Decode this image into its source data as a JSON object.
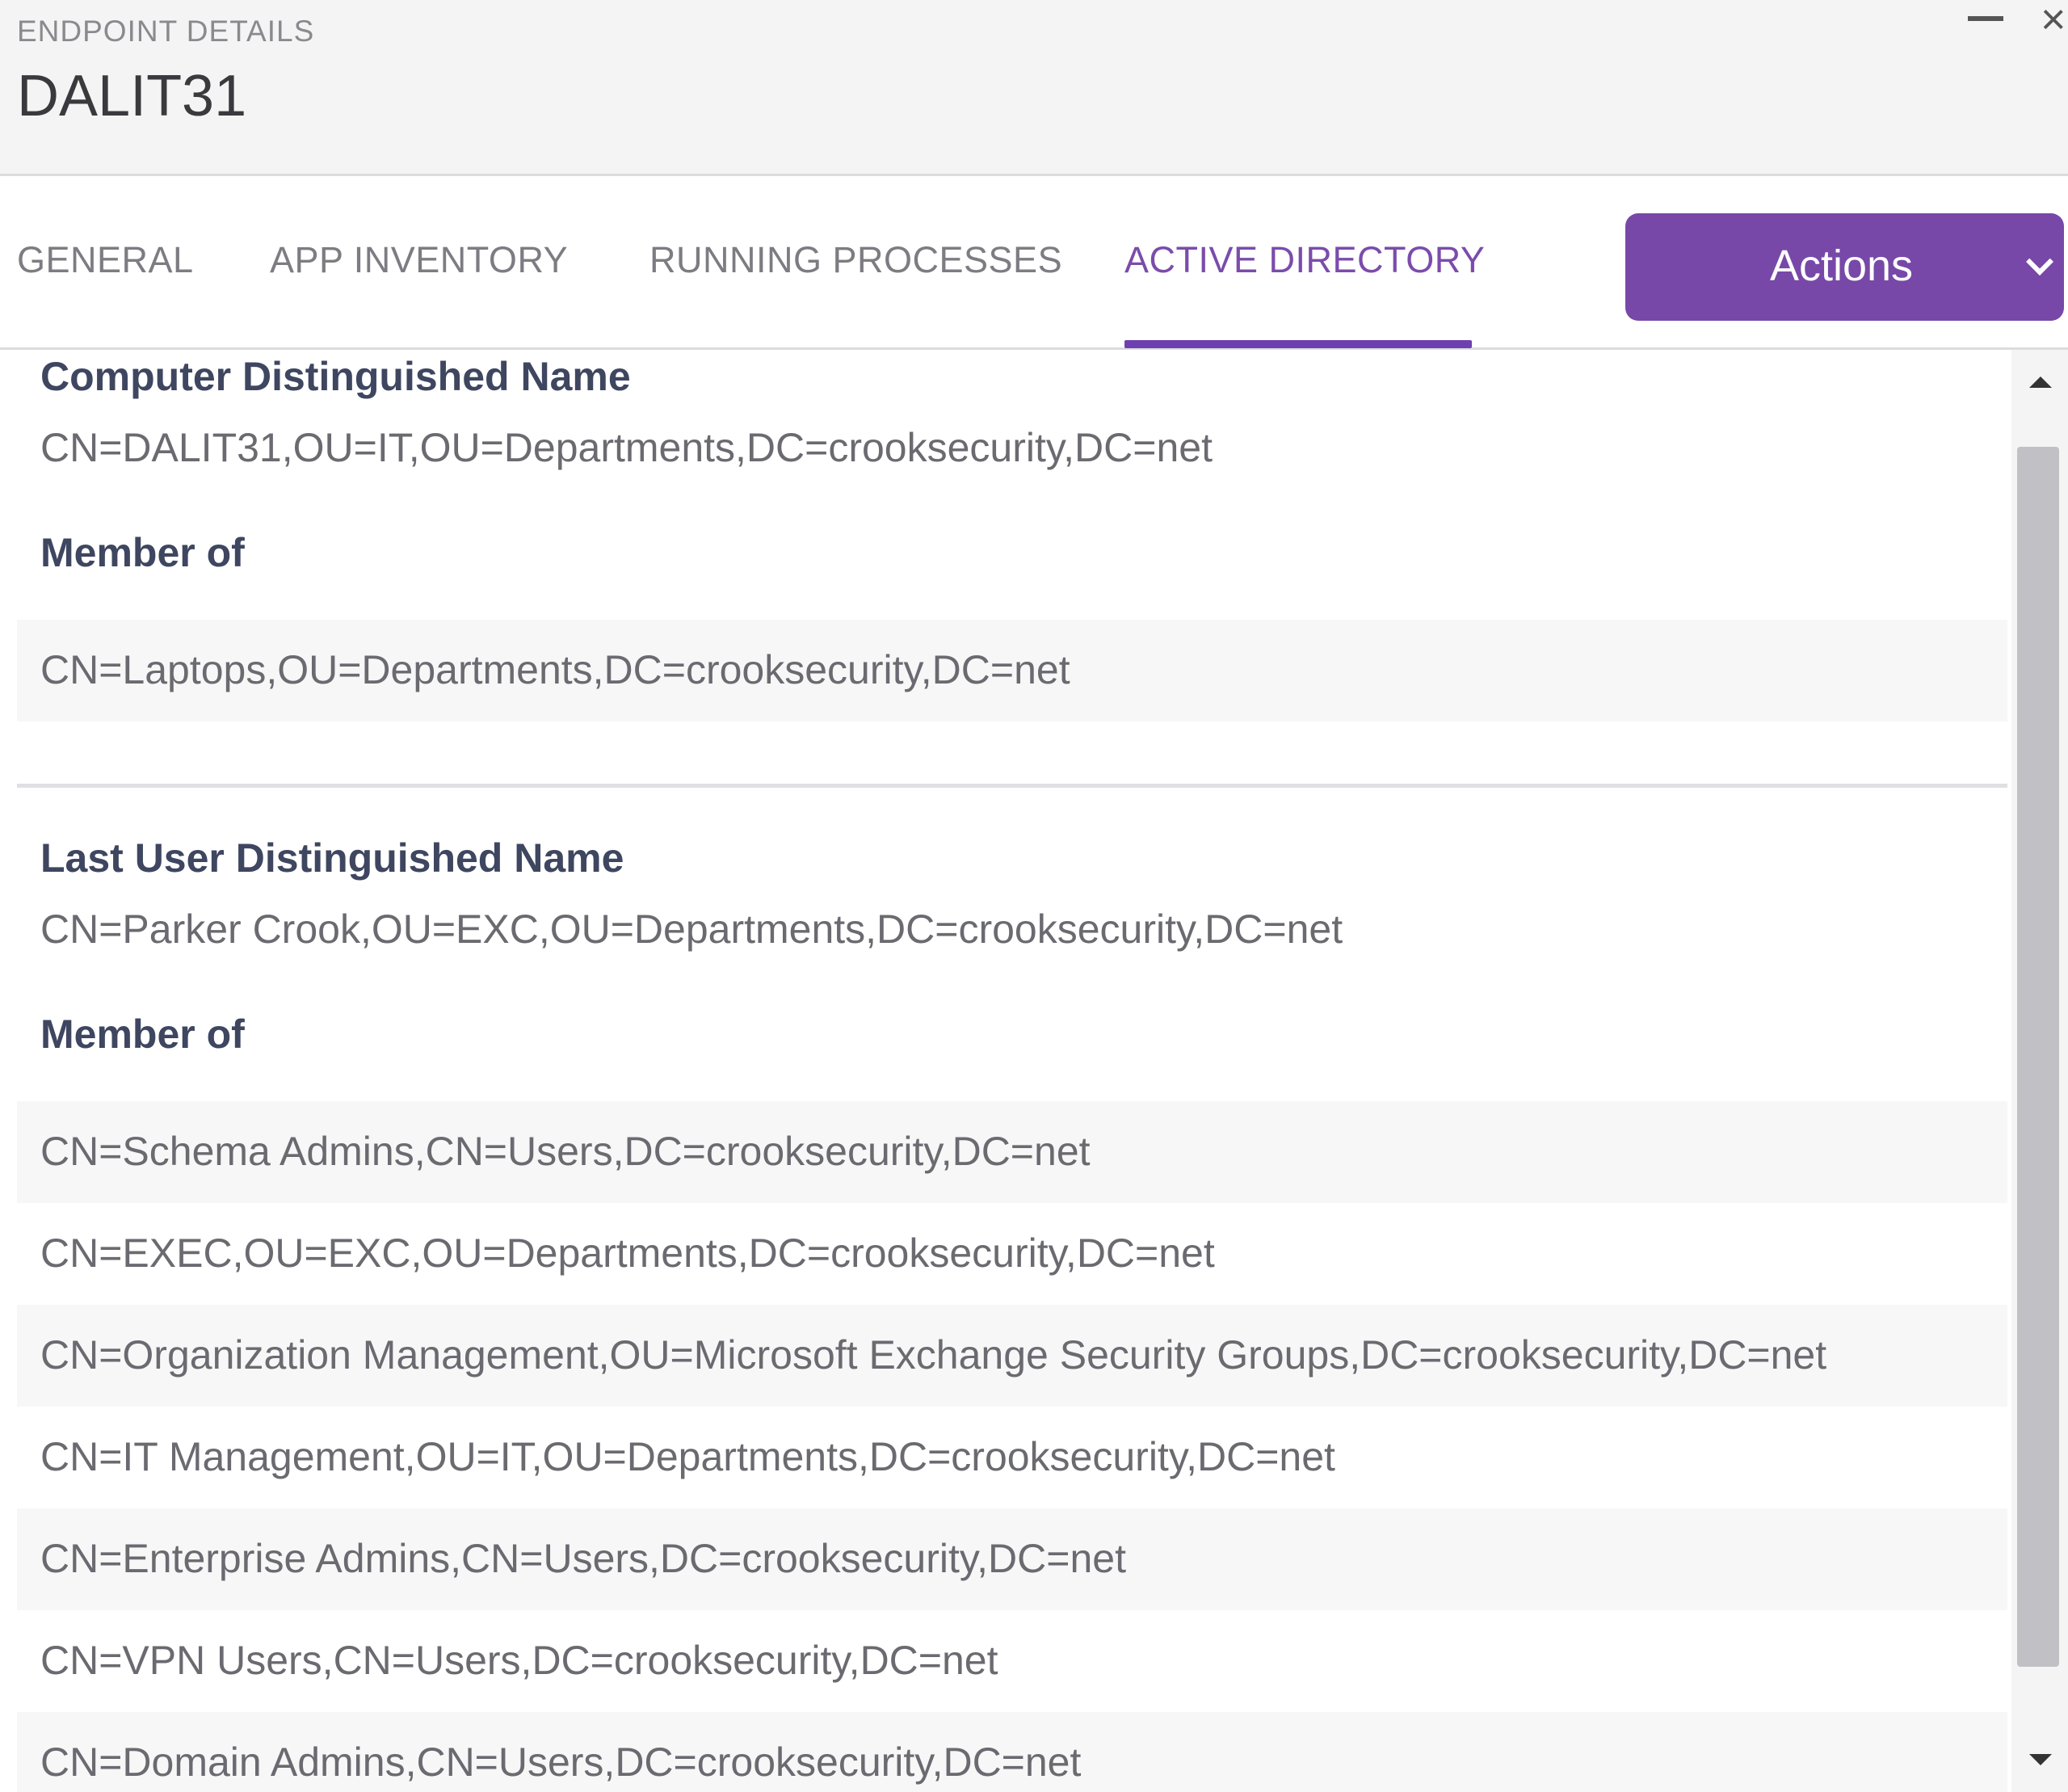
{
  "header": {
    "eyebrow": "ENDPOINT DETAILS",
    "title": "DALIT31"
  },
  "window": {
    "minimize_icon": "minimize-icon",
    "close_icon": "close-icon",
    "close_glyph": "×"
  },
  "tabs": [
    {
      "label": "GENERAL",
      "active": false
    },
    {
      "label": "APP INVENTORY",
      "active": false
    },
    {
      "label": "RUNNING PROCESSES",
      "active": false
    },
    {
      "label": "ACTIVE DIRECTORY",
      "active": true
    }
  ],
  "actions": {
    "label": "Actions",
    "icon": "chevron-down-icon",
    "color": "#7748a8"
  },
  "accent_color": "#6e3fb0",
  "computer": {
    "dn_label": "Computer Distinguished Name",
    "dn_value": "CN=DALIT31,OU=IT,OU=Departments,DC=crooksecurity,DC=net",
    "member_of_label": "Member of",
    "groups": [
      "CN=Laptops,OU=Departments,DC=crooksecurity,DC=net"
    ]
  },
  "user": {
    "dn_label": "Last User Distinguished Name",
    "dn_value": "CN=Parker Crook,OU=EXC,OU=Departments,DC=crooksecurity,DC=net",
    "member_of_label": "Member of",
    "groups": [
      "CN=Schema Admins,CN=Users,DC=crooksecurity,DC=net",
      "CN=EXEC,OU=EXC,OU=Departments,DC=crooksecurity,DC=net",
      "CN=Organization Management,OU=Microsoft Exchange Security Groups,DC=crooksecurity,DC=net",
      "CN=IT Management,OU=IT,OU=Departments,DC=crooksecurity,DC=net",
      "CN=Enterprise Admins,CN=Users,DC=crooksecurity,DC=net",
      "CN=VPN Users,CN=Users,DC=crooksecurity,DC=net",
      "CN=Domain Admins,CN=Users,DC=crooksecurity,DC=net"
    ]
  }
}
